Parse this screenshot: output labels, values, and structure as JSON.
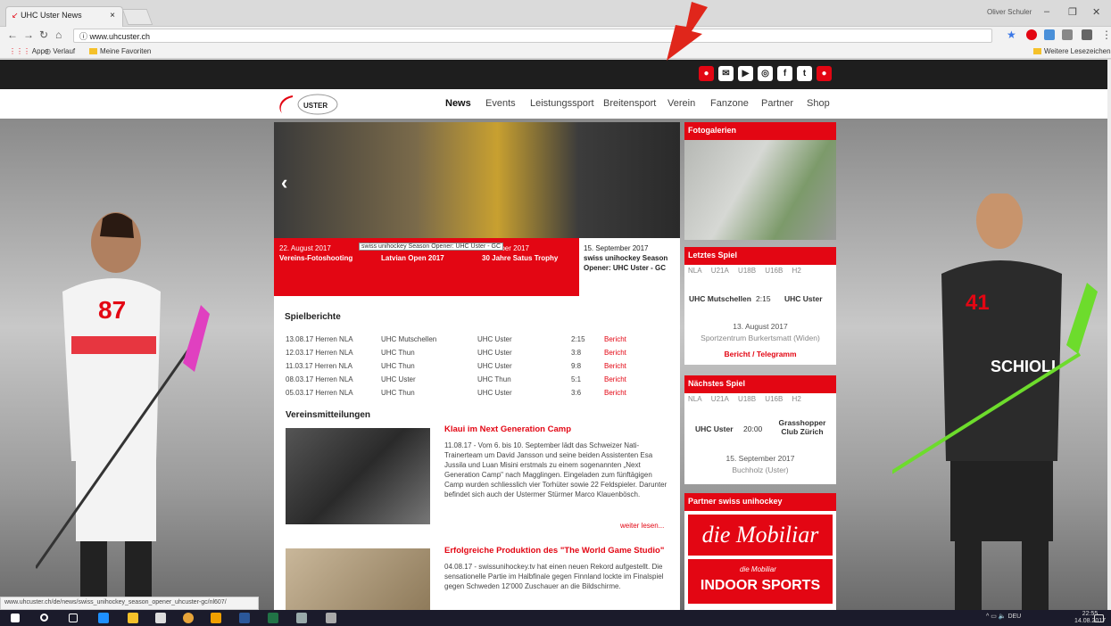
{
  "browser": {
    "tab_title": "UHC Uster News",
    "tab_close": "×",
    "user": "Oliver Schuler",
    "url": "www.uhcuster.ch",
    "bookmarks": {
      "apps": "Apps",
      "verlauf": "Verlauf",
      "favoriten": "Meine Favoriten",
      "weitere": "Weitere Lesezeichen"
    },
    "status_url": "www.uhcuster.ch/de/news/swiss_unihockey_season_opener_uhcuster-gc/nl607/"
  },
  "site": {
    "logo_text": "UHC USTER",
    "nav": [
      "News",
      "Events",
      "Leistungssport",
      "Breitensport",
      "Verein",
      "Fanzone",
      "Partner",
      "Shop"
    ],
    "social": [
      "person-icon",
      "mail-icon",
      "youtube-icon",
      "instagram-icon",
      "facebook-icon",
      "twitter-icon",
      "person-icon"
    ],
    "carousel": {
      "captions": [
        {
          "date": "22. August 2017",
          "title": "Vereins-Fotoshooting"
        },
        {
          "date": "",
          "title": "Latvian Open 2017"
        },
        {
          "date": "…tember 2017",
          "title": "30 Jahre Satus Trophy"
        }
      ],
      "tooltip": "swiss unihockey Season Opener: UHC Uster - GC",
      "highlight": {
        "date": "15. September 2017",
        "title": "swiss unihockey Season Opener: UHC Uster - GC"
      }
    },
    "spielberichte": {
      "title": "Spielberichte",
      "rows": [
        {
          "date": "13.08.17 Herren NLA",
          "home": "UHC Mutschellen",
          "away": "UHC Uster",
          "score": "2:15",
          "link": "Bericht"
        },
        {
          "date": "12.03.17 Herren NLA",
          "home": "UHC Thun",
          "away": "UHC Uster",
          "score": "3:8",
          "link": "Bericht"
        },
        {
          "date": "11.03.17 Herren NLA",
          "home": "UHC Thun",
          "away": "UHC Uster",
          "score": "9:8",
          "link": "Bericht"
        },
        {
          "date": "08.03.17 Herren NLA",
          "home": "UHC Uster",
          "away": "UHC Thun",
          "score": "5:1",
          "link": "Bericht"
        },
        {
          "date": "05.03.17 Herren NLA",
          "home": "UHC Thun",
          "away": "UHC Uster",
          "score": "3:6",
          "link": "Bericht"
        }
      ]
    },
    "vereinsmitteilungen": {
      "title": "Vereinsmitteilungen",
      "news1": {
        "title": "Klaui im Next Generation Camp",
        "body": "11.08.17 - Vom 6. bis 10. September lädt das Schweizer Nati-Trainerteam um David Jansson und seine beiden Assistenten Esa Jussila und Luan Misini erstmals zu einem sogenannten „Next Generation Camp\" nach Magglingen. Eingeladen zum fünftägigen Camp wurden schliesslich vier Torhüter sowie 22 Feldspieler. Darunter befindet sich auch der Ustermer Stürmer Marco Klauenbösch.",
        "more": "weiter lesen..."
      },
      "news2": {
        "title": "Erfolgreiche Produktion des \"The World Game Studio\"",
        "body": "04.08.17 - swissunihockey.tv hat einen neuen Rekord aufgestellt. Die sensationelle Partie im Halbfinale gegen Finnland lockte im Finalspiel gegen Schweden 12'000 Zuschauer an die Bildschirme."
      }
    },
    "sidebar": {
      "fotogalerien": "Fotogalerien",
      "letztes": {
        "title": "Letztes Spiel",
        "tabs": [
          "NLA",
          "U21A",
          "U18B",
          "U16B",
          "H2"
        ],
        "home": "UHC Mutschellen",
        "score": "2:15",
        "away": "UHC Uster",
        "date": "13. August 2017",
        "venue": "Sportzentrum Burkertsmatt (Widen)",
        "links": "Bericht / Telegramm"
      },
      "naechstes": {
        "title": "Nächstes Spiel",
        "tabs": [
          "NLA",
          "U21A",
          "U18B",
          "U16B",
          "H2"
        ],
        "home": "UHC Uster",
        "time": "20:00",
        "away": "Grasshopper Club Zürich",
        "date": "15. September 2017",
        "venue": "Buchholz (Uster)"
      },
      "partner": {
        "title": "Partner swiss unihockey",
        "mobiliar": "die Mobiliar",
        "indoor": "INDOOR SPORTS",
        "indoor_small": "die Mobiliar"
      }
    }
  },
  "taskbar": {
    "lang": "DEU",
    "time": "22:55",
    "date": "14.08.2017"
  },
  "colors": {
    "brand": "#e30613",
    "annotation_arrow": "#e0261b"
  }
}
